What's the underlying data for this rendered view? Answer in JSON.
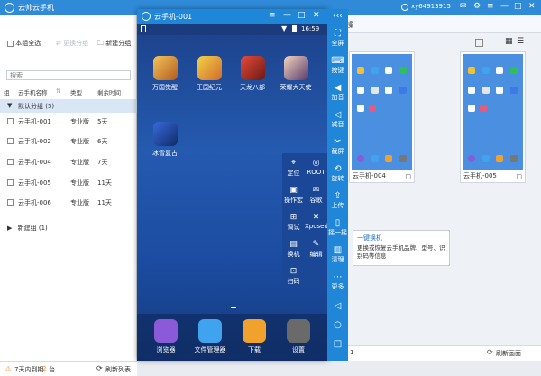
{
  "window": {
    "title": "云帅云手机",
    "account": "xy64913915"
  },
  "leftpanel": {
    "select_all": "本组全选",
    "change_group": "更换分组",
    "new_group": "新建分组",
    "search_placeholder": "搜索",
    "columns": [
      "组",
      "云手机名称",
      "类型",
      "剩余时间"
    ],
    "default_group": "默认分组 (5)",
    "rows": [
      {
        "name": "云手机-001",
        "type": "专业版",
        "time": "5天"
      },
      {
        "name": "云手机-002",
        "type": "专业版",
        "time": "6天"
      },
      {
        "name": "云手机-004",
        "type": "专业版",
        "time": "7天"
      },
      {
        "name": "云手机-005",
        "type": "专业版",
        "time": "11天"
      },
      {
        "name": "云手机-006",
        "type": "专业版",
        "time": "11天"
      }
    ],
    "new_group_row": "新建组 (1)",
    "expiring_text": "7天内到期",
    "expiring_count": "2",
    "expiring_unit": "台",
    "refresh_list": "刷新列表"
  },
  "rightarea": {
    "header_text": "操",
    "thumbs": [
      {
        "label": "云手机-004"
      },
      {
        "label": "云手机-005"
      }
    ],
    "refresh_screen": "刷新画面",
    "footer_num": "1"
  },
  "phone": {
    "title": "云手机-001",
    "time": "16:59",
    "apps": [
      "万国觉醒",
      "王国纪元",
      "天龙八部",
      "荣耀大天使",
      "冰雪复古"
    ],
    "dock": [
      "浏览器",
      "文件管理器",
      "下载",
      "设置"
    ]
  },
  "sidebar": {
    "items": [
      "全屏",
      "按键",
      "加音",
      "减音",
      "截屏",
      "旋转",
      "上传",
      "摇一摇",
      "清理",
      "更多"
    ]
  },
  "popup": {
    "items": [
      "定位",
      "ROOT",
      "操作宏",
      "谷歌",
      "调试",
      "Xposed",
      "换机",
      "编辑",
      "扫码"
    ]
  },
  "tooltip": {
    "title": "一键换机",
    "desc": "更换或恢复云手机品牌、型号、识别码等信息"
  },
  "colors": {
    "accent": "#2f8ad8",
    "sidebar": "#1f86d8",
    "warn": "#e8862c"
  }
}
